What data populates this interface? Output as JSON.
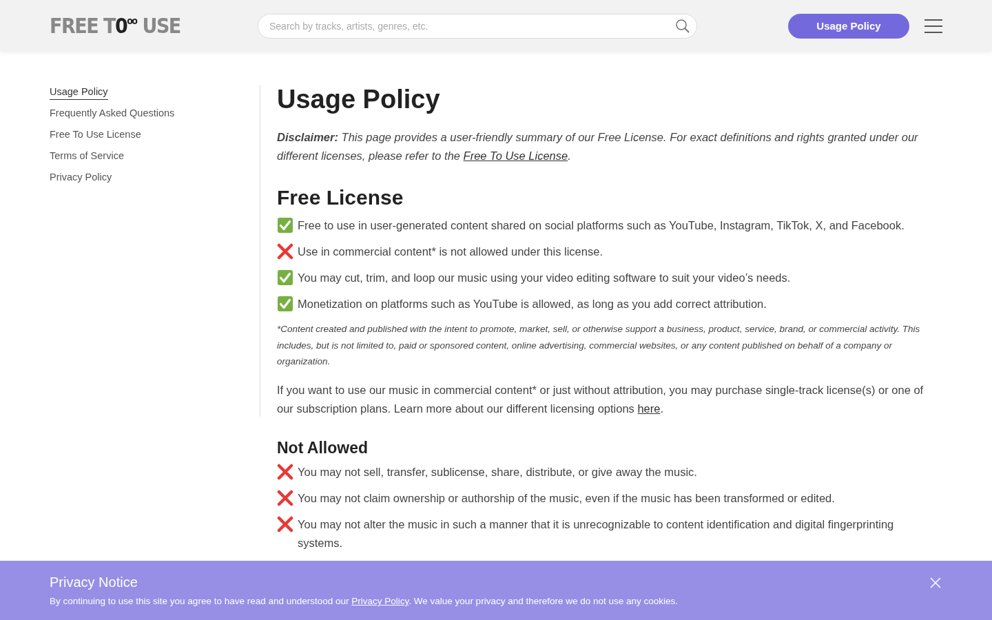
{
  "header": {
    "logo": [
      "FREE T",
      "0",
      "oo",
      "USE"
    ],
    "search": {
      "placeholder": "Search by tracks, artists, genres, etc."
    },
    "button": "Usage Policy"
  },
  "sidebar": {
    "items": [
      {
        "label": "Usage Policy",
        "selected": true
      },
      {
        "label": "Frequently Asked Questions",
        "selected": false
      },
      {
        "label": "Free To Use License",
        "selected": false
      },
      {
        "label": "Terms of Service",
        "selected": false
      },
      {
        "label": "Privacy Policy",
        "selected": false
      }
    ]
  },
  "content": {
    "title": "Usage Policy",
    "disclaimer": {
      "before": "**Disclaimer:** This page provides a user-friendly summary of our Free License. For exact definitions and rights granted under our different licenses, please refer to the ",
      "link": "Free To Use License",
      "after": "."
    },
    "sections": [
      {
        "heading": "Free License",
        "kind": "major",
        "items": [
          {
            "kind": "allowed",
            "text": "Free to use in user-generated content shared on social platforms such as YouTube, Instagram, TikTok, X, and Facebook."
          },
          {
            "kind": "not_allowed",
            "text": "Use in commercial content* is not allowed under this license."
          },
          {
            "kind": "allowed",
            "text": "You may cut, trim, and loop our music using your video editing software to suit your video’s needs."
          },
          {
            "kind": "allowed",
            "text": "Monetization on platforms such as YouTube is allowed, as long as you add correct attribution."
          }
        ],
        "footnote": "*Content created and published with the intent to promote, market, sell, or otherwise support a business, product, service, brand, or commercial activity. This includes, but is not limited to, paid or sponsored content, online advertising, commercial websites, or any content published on behalf of a company or organization.",
        "paragraph": {
          "before": "If you want to use our music in commercial content* or just without attribution, you may purchase single-track license(s) or one of our subscription plans. Learn more about our different licensing options ",
          "link": "here",
          "after": "."
        }
      },
      {
        "heading": "Not Allowed",
        "kind": "minor",
        "items": [
          {
            "kind": "not_allowed",
            "text": "You may not sell, transfer, sublicense, share, distribute, or give away the music."
          },
          {
            "kind": "not_allowed",
            "text": "You may not claim ownership or authorship of the music, even if the music has been transformed or edited."
          },
          {
            "kind": "not_allowed",
            "text": "You may not alter the music in such a manner that it is unrecognizable to content identification and digital fingerprinting systems."
          }
        ]
      }
    ]
  },
  "privacy_notice": {
    "title": "Privacy Notice",
    "before": "By continuing to use this site you agree to have read and understood our ",
    "link": "Privacy Policy",
    "after": ". We value your privacy and therefore we do not use any cookies."
  }
}
